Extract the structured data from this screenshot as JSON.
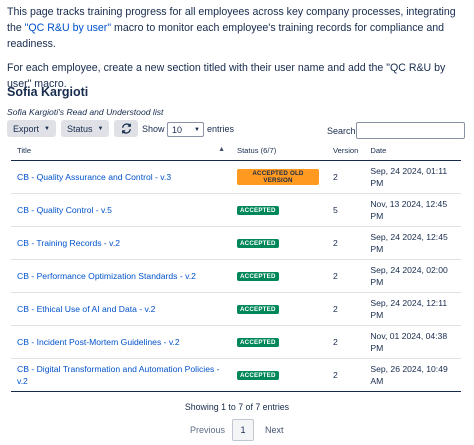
{
  "intro": {
    "p1_before": "This page tracks training progress for all employees across key company processes, integrating the ",
    "p1_link": "\"QC R&U by user\"",
    "p1_after": " macro to monitor each employee's training records for compliance and readiness.",
    "p2": "For each employee, create a new section titled with their user name and add the \"QC R&U by user\" macro."
  },
  "section": {
    "user_name": "Sofia Kargioti",
    "list_caption": "Sofia Kargioti's Read and Understood list"
  },
  "toolbar": {
    "export_label": "Export",
    "status_label": "Status",
    "refresh_icon": "refresh-icon",
    "show_label": "Show",
    "page_size": "10",
    "entries_label": "entries",
    "search_label": "Search:",
    "search_value": ""
  },
  "table": {
    "headers": {
      "title": "Title",
      "status": "Status (6/7)",
      "version": "Version",
      "date": "Date"
    },
    "rows": [
      {
        "title": "CB - Quality Assurance and Control - v.3",
        "status": "ACCEPTED OLD VERSION",
        "status_kind": "old",
        "version": "2",
        "date": "Sep, 24 2024, 01:11 PM"
      },
      {
        "title": "CB - Quality Control - v.5",
        "status": "ACCEPTED",
        "status_kind": "accepted",
        "version": "5",
        "date": "Nov, 13 2024, 12:45 PM"
      },
      {
        "title": "CB - Training Records - v.2",
        "status": "ACCEPTED",
        "status_kind": "accepted",
        "version": "2",
        "date": "Sep, 24 2024, 12:45 PM"
      },
      {
        "title": "CB - Performance Optimization Standards - v.2",
        "status": "ACCEPTED",
        "status_kind": "accepted",
        "version": "2",
        "date": "Sep, 24 2024, 02:00 PM"
      },
      {
        "title": "CB - Ethical Use of AI and Data - v.2",
        "status": "ACCEPTED",
        "status_kind": "accepted",
        "version": "2",
        "date": "Sep, 24 2024, 12:11 PM"
      },
      {
        "title": "CB - Incident Post-Mortem Guidelines - v.2",
        "status": "ACCEPTED",
        "status_kind": "accepted",
        "version": "2",
        "date": "Nov, 01 2024, 04:38 PM"
      },
      {
        "title": "CB - Digital Transformation and Automation Policies - v.2",
        "status": "ACCEPTED",
        "status_kind": "accepted",
        "version": "2",
        "date": "Sep, 26 2024, 10:49 AM"
      }
    ]
  },
  "footer": {
    "info": "Showing 1 to 7 of 7 entries",
    "previous": "Previous",
    "page": "1",
    "next": "Next"
  },
  "colors": {
    "accepted": "#00875a",
    "accepted_old": "#ff991f",
    "link": "#0052cc"
  }
}
